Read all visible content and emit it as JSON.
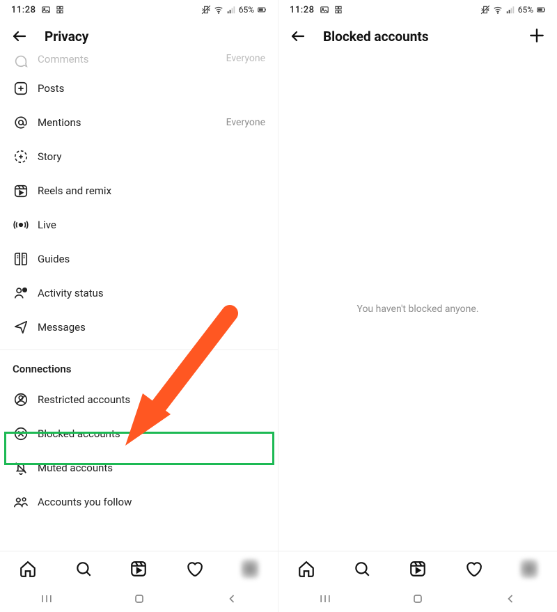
{
  "status": {
    "time": "11:28",
    "battery": "65%"
  },
  "left": {
    "title": "Privacy",
    "cut_row": {
      "label": "Comments",
      "tail": "Everyone"
    },
    "rows": [
      {
        "label": "Posts"
      },
      {
        "label": "Mentions",
        "tail": "Everyone"
      },
      {
        "label": "Story"
      },
      {
        "label": "Reels and remix"
      },
      {
        "label": "Live"
      },
      {
        "label": "Guides"
      },
      {
        "label": "Activity status"
      },
      {
        "label": "Messages"
      }
    ],
    "section": "Connections",
    "conn_rows": [
      {
        "label": "Restricted accounts"
      },
      {
        "label": "Blocked accounts"
      },
      {
        "label": "Muted accounts"
      },
      {
        "label": "Accounts you follow"
      }
    ]
  },
  "right": {
    "title": "Blocked accounts",
    "empty_text": "You haven't blocked anyone."
  },
  "annotation": {
    "highlight_color": "#1db954",
    "arrow_color": "#ff5722"
  }
}
